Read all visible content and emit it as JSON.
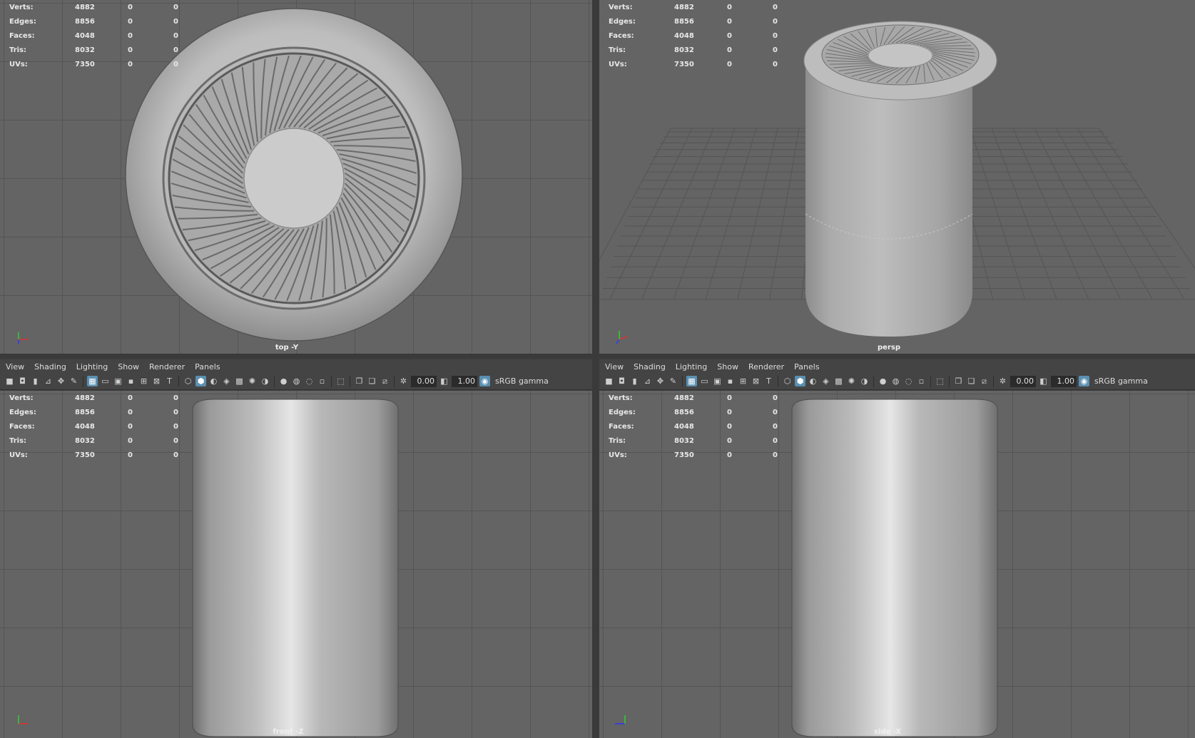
{
  "stats": {
    "rows": [
      {
        "label": "Verts:",
        "v1": "4882",
        "v2": "0",
        "v3": "0"
      },
      {
        "label": "Edges:",
        "v1": "8856",
        "v2": "0",
        "v3": "0"
      },
      {
        "label": "Faces:",
        "v1": "4048",
        "v2": "0",
        "v3": "0"
      },
      {
        "label": "Tris:",
        "v1": "8032",
        "v2": "0",
        "v3": "0"
      },
      {
        "label": "UVs:",
        "v1": "7350",
        "v2": "0",
        "v3": "0"
      }
    ]
  },
  "viewports": {
    "top": {
      "camera": "top -Y"
    },
    "persp": {
      "camera": "persp"
    },
    "front": {
      "camera": "front -Z"
    },
    "side": {
      "camera": "side -X"
    }
  },
  "menu": {
    "view": "View",
    "shading": "Shading",
    "lighting": "Lighting",
    "show": "Show",
    "renderer": "Renderer",
    "panels": "Panels"
  },
  "toolbar": {
    "exposure": "0.00",
    "gamma": "1.00",
    "color_space": "sRGB gamma"
  },
  "axis": {
    "x": "x",
    "y": "y",
    "z": "z"
  },
  "colors": {
    "active_icon": "#5a8fb0",
    "viewport_bg": "#646464",
    "grid": "#555555"
  }
}
